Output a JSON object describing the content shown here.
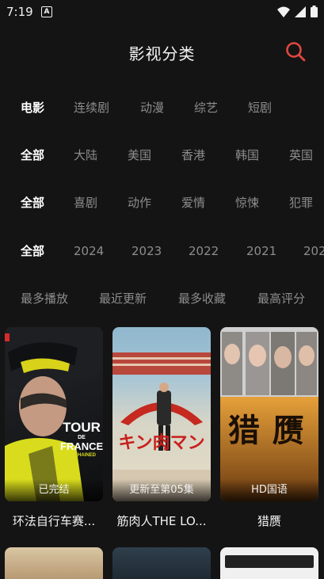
{
  "status": {
    "time": "7:19",
    "badge": "A"
  },
  "header": {
    "title": "影视分类",
    "search_icon": "search-icon"
  },
  "filters": {
    "type": [
      "电影",
      "连续剧",
      "动漫",
      "综艺",
      "短剧"
    ],
    "region": [
      "全部",
      "大陆",
      "美国",
      "香港",
      "韩国",
      "英国"
    ],
    "genre": [
      "全部",
      "喜剧",
      "动作",
      "爱情",
      "惊悚",
      "犯罪"
    ],
    "year": [
      "全部",
      "2024",
      "2023",
      "2022",
      "2021",
      "202"
    ],
    "sort": [
      "最多播放",
      "最近更新",
      "最多收藏",
      "最高评分"
    ]
  },
  "cards": [
    {
      "title": "环法自行车赛...",
      "badge": "已完结",
      "poster_text": [
        "TOUR",
        "DE",
        "FRANCE",
        "UNCHAINED"
      ]
    },
    {
      "title": "筋肉人THE LO...",
      "badge": "更新至第05集",
      "poster_text": [
        "キン肉マン"
      ]
    },
    {
      "title": "猎赝",
      "badge": "HD国语",
      "poster_text": [
        "猎",
        "赝"
      ]
    }
  ],
  "colors": {
    "background": "#141414",
    "accent": "#e0473f",
    "active_text": "#ffffff",
    "inactive_text": "#8d8d8d"
  }
}
